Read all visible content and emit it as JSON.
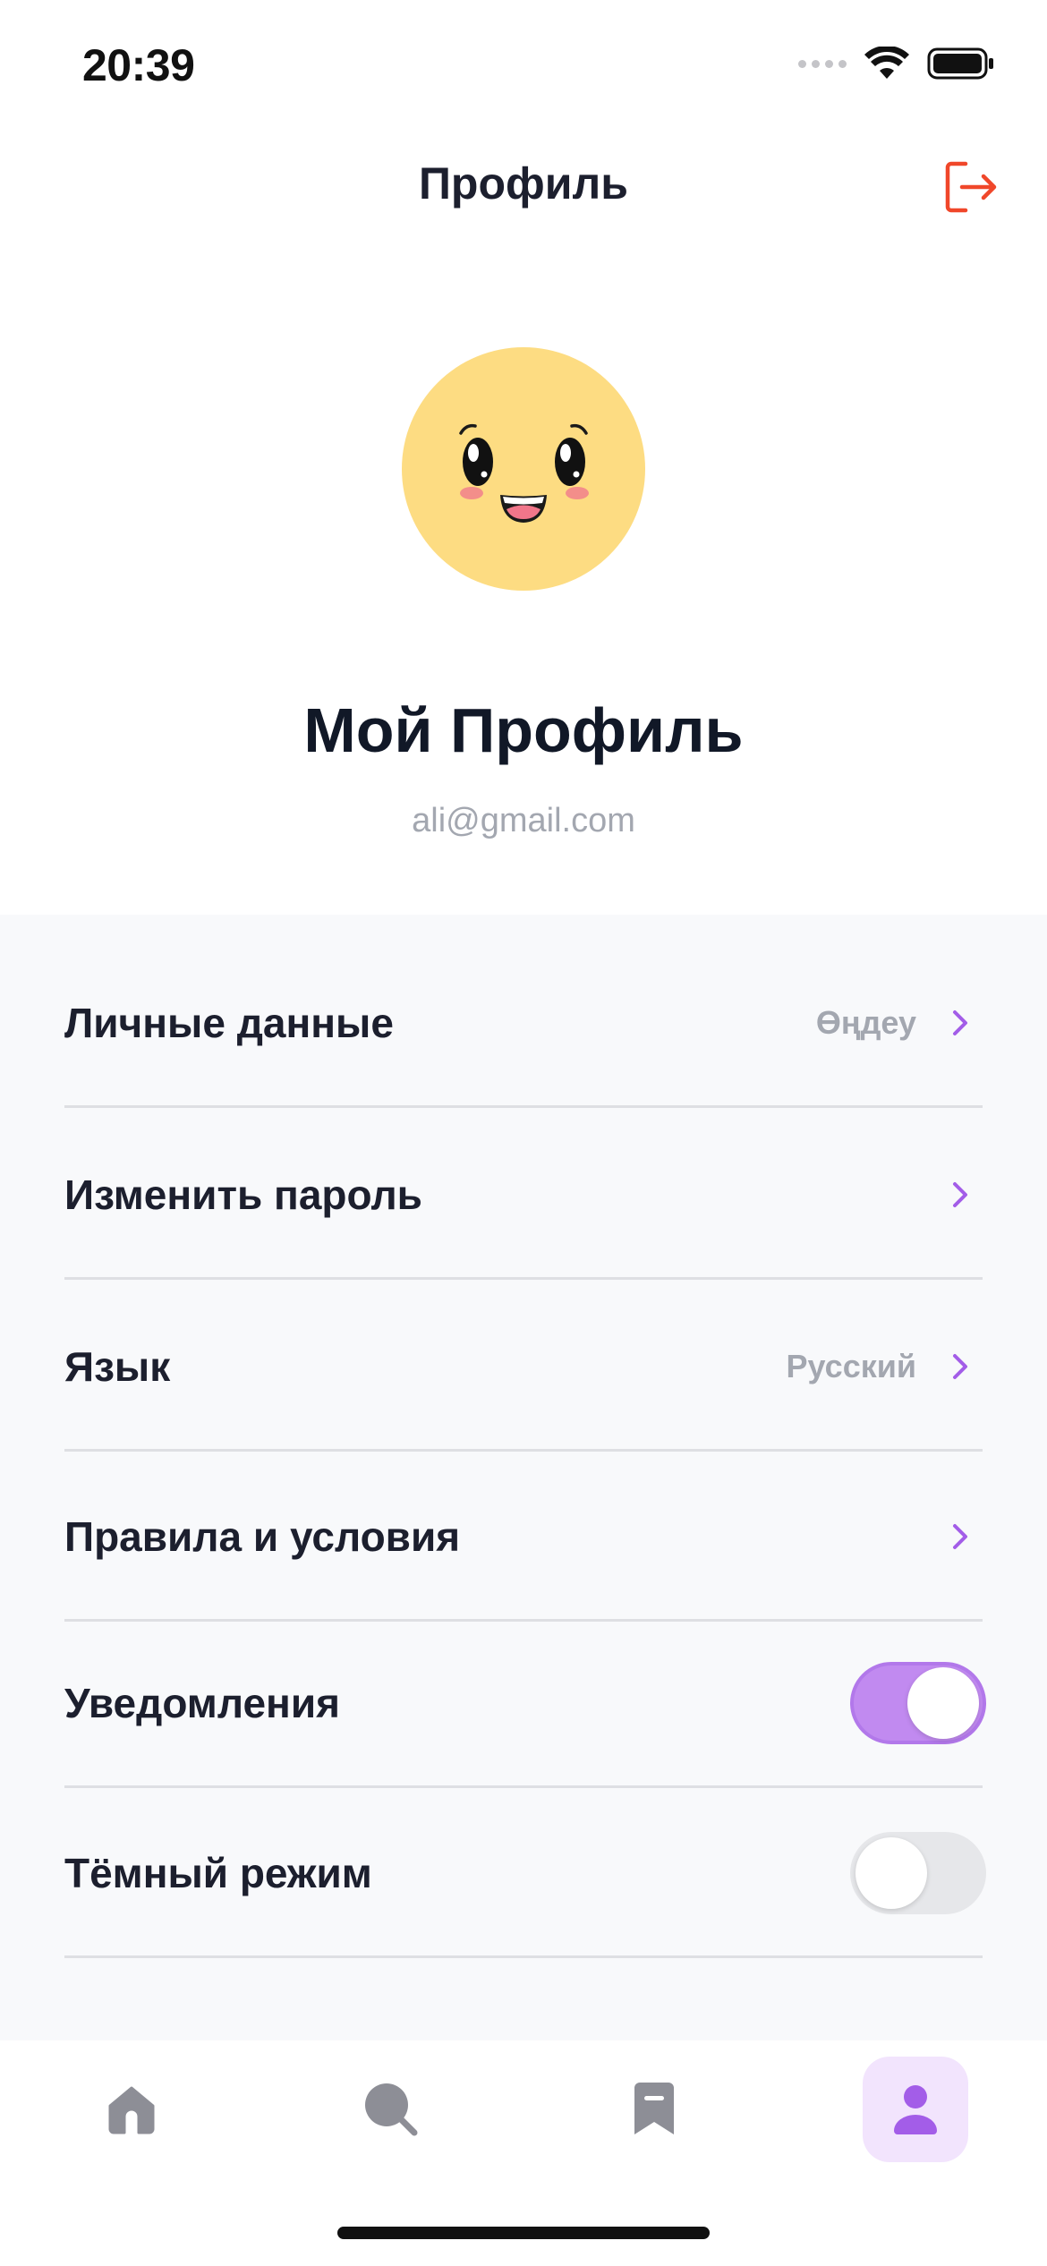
{
  "status_bar": {
    "time": "20:39"
  },
  "header": {
    "title": "Профиль",
    "logout_icon": "logout-icon"
  },
  "profile": {
    "name": "Мой Профиль",
    "email": "ali@gmail.com",
    "avatar": "smiley-avatar"
  },
  "settings": {
    "personal_data": {
      "label": "Личные данные",
      "value": "Өңдеу"
    },
    "change_password": {
      "label": "Изменить пароль"
    },
    "language": {
      "label": "Язык",
      "value": "Русский"
    },
    "terms": {
      "label": "Правила и условия"
    },
    "notifications": {
      "label": "Уведомления",
      "enabled": true
    },
    "dark_mode": {
      "label": "Тёмный режим",
      "enabled": false
    }
  },
  "tabbar": {
    "items": [
      {
        "name": "home",
        "icon": "home-icon",
        "active": false
      },
      {
        "name": "search",
        "icon": "search-icon",
        "active": false
      },
      {
        "name": "bookmarks",
        "icon": "bookmark-icon",
        "active": false
      },
      {
        "name": "profile",
        "icon": "profile-icon",
        "active": true
      }
    ]
  },
  "colors": {
    "accent": "#a35de8",
    "toggle_on": "#c18af0",
    "logout": "#f0472a",
    "avatar_bg": "#fddc82",
    "active_tab_bg": "#f2e4fd"
  }
}
